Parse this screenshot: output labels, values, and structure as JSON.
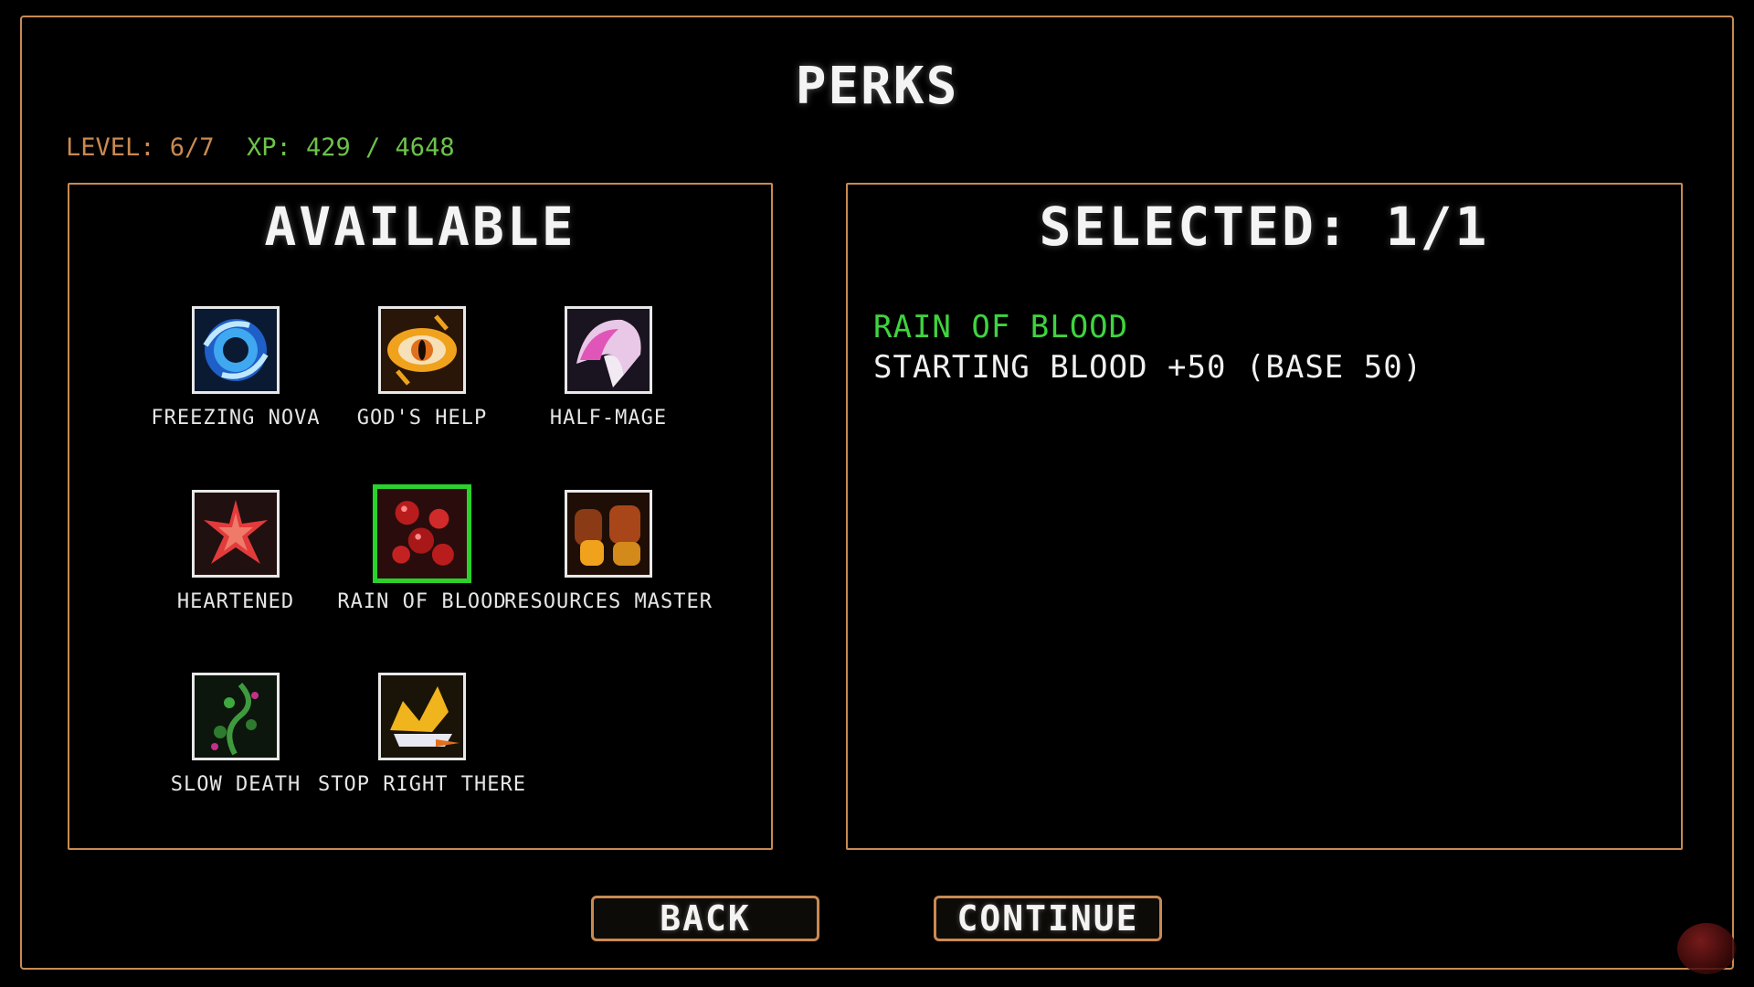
{
  "title": "PERKS",
  "level_text": "LEVEL: 6/7",
  "xp_text": "XP: 429 / 4648",
  "available": {
    "heading": "AVAILABLE",
    "perks": [
      {
        "name": "FREEZING NOVA",
        "icon": "freezing-nova-icon"
      },
      {
        "name": "GOD'S HELP",
        "icon": "gods-help-icon"
      },
      {
        "name": "HALF-MAGE",
        "icon": "half-mage-icon"
      },
      {
        "name": "HEARTENED",
        "icon": "heartened-icon"
      },
      {
        "name": "RAIN OF BLOOD",
        "icon": "rain-of-blood-icon",
        "selected": true
      },
      {
        "name": "RESOURCES MASTER",
        "icon": "resources-master-icon"
      },
      {
        "name": "SLOW DEATH",
        "icon": "slow-death-icon"
      },
      {
        "name": "STOP RIGHT THERE",
        "icon": "stop-right-there-icon"
      }
    ]
  },
  "selected": {
    "heading": "SELECTED: 1/1",
    "perk_name": "RAIN OF BLOOD",
    "perk_description": "STARTING BLOOD +50 (BASE 50)"
  },
  "buttons": {
    "back": "BACK",
    "continue": "CONTINUE"
  },
  "colors": {
    "accent": "#c98a52",
    "xp": "#6cc24a",
    "selected": "#2bd12b"
  }
}
